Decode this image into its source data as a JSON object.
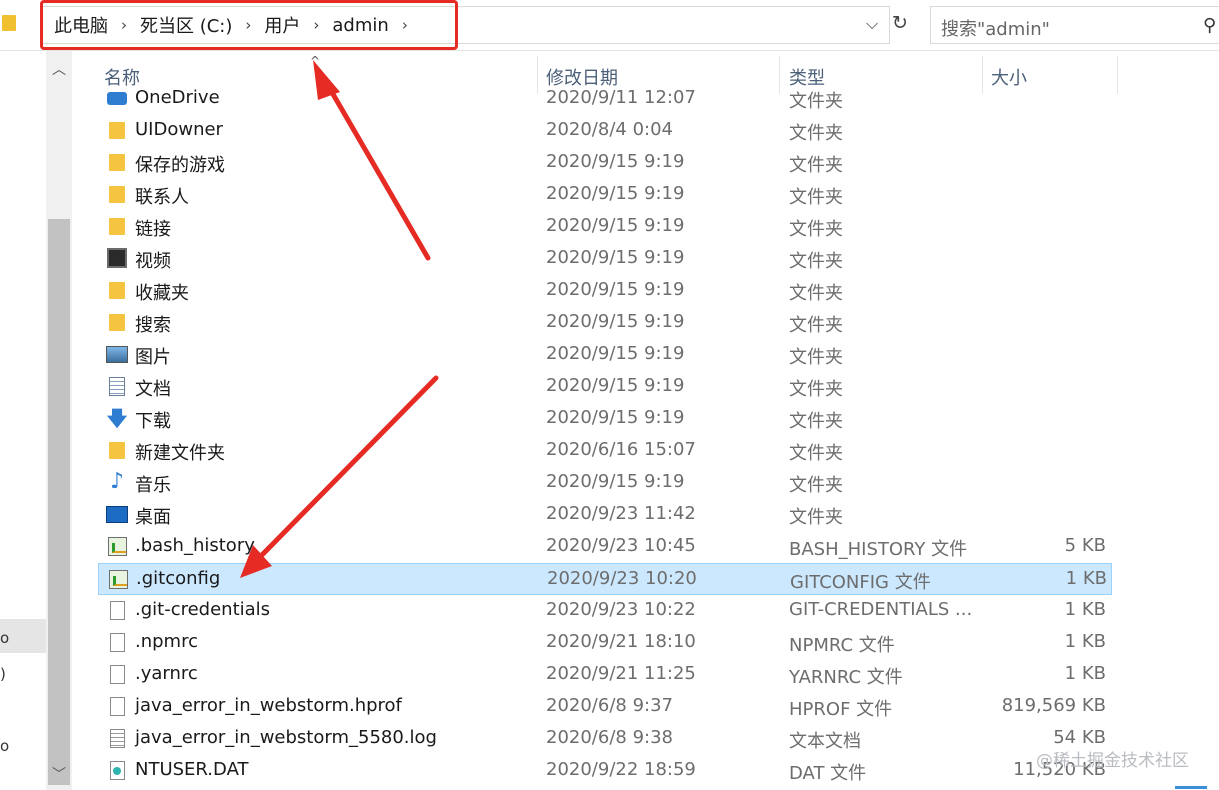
{
  "breadcrumb": {
    "items": [
      "此电脑",
      "死当区 (C:)",
      "用户",
      "admin"
    ],
    "separator": "›"
  },
  "search": {
    "placeholder": "搜索\"admin\""
  },
  "columns": {
    "name": "名称",
    "date": "修改日期",
    "type": "类型",
    "size": "大小"
  },
  "nav_marks": [
    "o",
    ")",
    "o"
  ],
  "files": [
    {
      "name": "OneDrive",
      "date": "2020/9/11 12:07",
      "type": "文件夹",
      "size": "",
      "icon": "onedrive-folder-icon",
      "partial": true
    },
    {
      "name": "UIDowner",
      "date": "2020/8/4 0:04",
      "type": "文件夹",
      "size": "",
      "icon": "folder-icon"
    },
    {
      "name": "保存的游戏",
      "date": "2020/9/15 9:19",
      "type": "文件夹",
      "size": "",
      "icon": "saved-games-folder-icon"
    },
    {
      "name": "联系人",
      "date": "2020/9/15 9:19",
      "type": "文件夹",
      "size": "",
      "icon": "contacts-folder-icon"
    },
    {
      "name": "链接",
      "date": "2020/9/15 9:19",
      "type": "文件夹",
      "size": "",
      "icon": "links-folder-icon"
    },
    {
      "name": "视频",
      "date": "2020/9/15 9:19",
      "type": "文件夹",
      "size": "",
      "icon": "videos-folder-icon"
    },
    {
      "name": "收藏夹",
      "date": "2020/9/15 9:19",
      "type": "文件夹",
      "size": "",
      "icon": "favorites-folder-icon"
    },
    {
      "name": "搜索",
      "date": "2020/9/15 9:19",
      "type": "文件夹",
      "size": "",
      "icon": "searches-folder-icon"
    },
    {
      "name": "图片",
      "date": "2020/9/15 9:19",
      "type": "文件夹",
      "size": "",
      "icon": "pictures-folder-icon"
    },
    {
      "name": "文档",
      "date": "2020/9/15 9:19",
      "type": "文件夹",
      "size": "",
      "icon": "documents-folder-icon"
    },
    {
      "name": "下载",
      "date": "2020/9/15 9:19",
      "type": "文件夹",
      "size": "",
      "icon": "downloads-folder-icon"
    },
    {
      "name": "新建文件夹",
      "date": "2020/6/16 15:07",
      "type": "文件夹",
      "size": "",
      "icon": "folder-icon"
    },
    {
      "name": "音乐",
      "date": "2020/9/15 9:19",
      "type": "文件夹",
      "size": "",
      "icon": "music-folder-icon"
    },
    {
      "name": "桌面",
      "date": "2020/9/23 11:42",
      "type": "文件夹",
      "size": "",
      "icon": "desktop-folder-icon"
    },
    {
      "name": ".bash_history",
      "date": "2020/9/23 10:45",
      "type": "BASH_HISTORY 文件",
      "size": "5 KB",
      "icon": "text-editor-file-icon"
    },
    {
      "name": ".gitconfig",
      "date": "2020/9/23 10:20",
      "type": "GITCONFIG 文件",
      "size": "1 KB",
      "icon": "text-editor-file-icon",
      "selected": true
    },
    {
      "name": ".git-credentials",
      "date": "2020/9/23 10:22",
      "type": "GIT-CREDENTIALS ...",
      "size": "1 KB",
      "icon": "blank-file-icon"
    },
    {
      "name": ".npmrc",
      "date": "2020/9/21 18:10",
      "type": "NPMRC 文件",
      "size": "1 KB",
      "icon": "blank-file-icon"
    },
    {
      "name": ".yarnrc",
      "date": "2020/9/21 11:25",
      "type": "YARNRC 文件",
      "size": "1 KB",
      "icon": "blank-file-icon"
    },
    {
      "name": "java_error_in_webstorm.hprof",
      "date": "2020/6/8 9:37",
      "type": "HPROF 文件",
      "size": "819,569 KB",
      "icon": "blank-file-icon"
    },
    {
      "name": "java_error_in_webstorm_5580.log",
      "date": "2020/6/8 9:38",
      "type": "文本文档",
      "size": "54 KB",
      "icon": "text-document-icon"
    },
    {
      "name": "NTUSER.DAT",
      "date": "2020/9/22 18:59",
      "type": "DAT 文件",
      "size": "11,520 KB",
      "icon": "dat-file-icon"
    }
  ],
  "watermark": "@稀土掘金技术社区",
  "colors": {
    "selection": "#cce8ff",
    "annotation": "#e52b24",
    "header_text": "#4c607a"
  }
}
